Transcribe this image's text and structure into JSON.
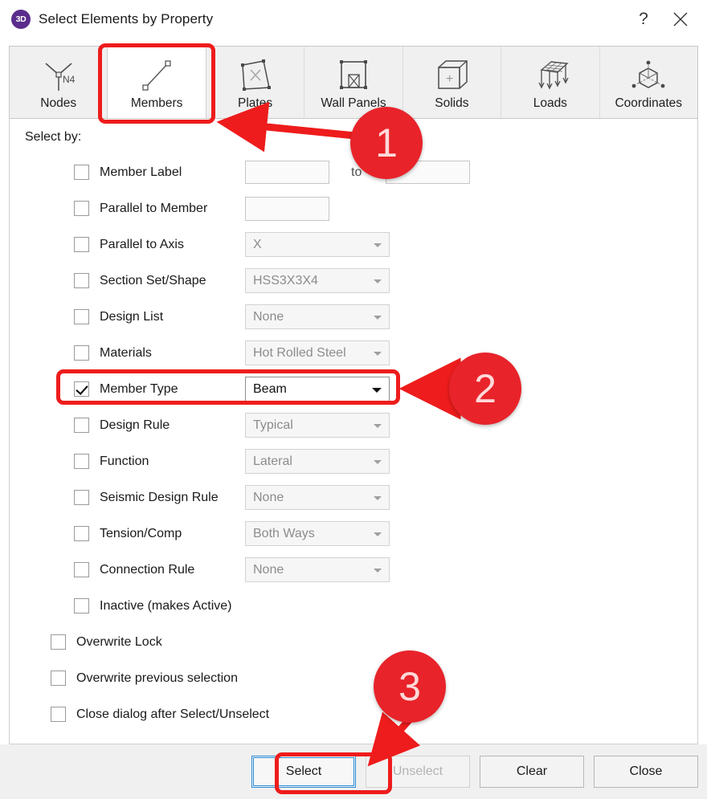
{
  "titlebar": {
    "app_badge": "3D",
    "title": "Select Elements by Property",
    "help_label": "?",
    "close_label": "Close"
  },
  "tabs": [
    {
      "label": "Nodes",
      "icon": "nodes-icon",
      "active": false
    },
    {
      "label": "Members",
      "icon": "members-icon",
      "active": true
    },
    {
      "label": "Plates",
      "icon": "plates-icon",
      "active": false
    },
    {
      "label": "Wall Panels",
      "icon": "wall-panels-icon",
      "active": false
    },
    {
      "label": "Solids",
      "icon": "solids-icon",
      "active": false
    },
    {
      "label": "Loads",
      "icon": "loads-icon",
      "active": false
    },
    {
      "label": "Coordinates",
      "icon": "coordinates-icon",
      "active": false
    }
  ],
  "node_icon_label": "N4",
  "panel": {
    "select_by_label": "Select by:",
    "to_label": "to",
    "rows": [
      {
        "label": "Member Label",
        "checked": false,
        "control": "range",
        "value": "",
        "value2": ""
      },
      {
        "label": "Parallel to Member",
        "checked": false,
        "control": "text",
        "value": ""
      },
      {
        "label": "Parallel to Axis",
        "checked": false,
        "control": "combo",
        "value": "X",
        "enabled": false
      },
      {
        "label": "Section Set/Shape",
        "checked": false,
        "control": "combo",
        "value": "HSS3X3X4",
        "enabled": false
      },
      {
        "label": "Design List",
        "checked": false,
        "control": "combo",
        "value": "None",
        "enabled": false
      },
      {
        "label": "Materials",
        "checked": false,
        "control": "combo",
        "value": "Hot Rolled Steel",
        "enabled": false
      },
      {
        "label": "Member Type",
        "checked": true,
        "control": "combo",
        "value": "Beam",
        "enabled": true
      },
      {
        "label": "Design Rule",
        "checked": false,
        "control": "combo",
        "value": "Typical",
        "enabled": false
      },
      {
        "label": "Function",
        "checked": false,
        "control": "combo",
        "value": "Lateral",
        "enabled": false
      },
      {
        "label": "Seismic Design Rule",
        "checked": false,
        "control": "combo",
        "value": "None",
        "enabled": false
      },
      {
        "label": "Tension/Comp",
        "checked": false,
        "control": "combo",
        "value": "Both Ways",
        "enabled": false
      },
      {
        "label": "Connection Rule",
        "checked": false,
        "control": "combo",
        "value": "None",
        "enabled": false
      },
      {
        "label": "Inactive (makes Active)",
        "checked": false,
        "control": "none"
      }
    ],
    "options": [
      {
        "label": "Overwrite Lock",
        "checked": false
      },
      {
        "label": "Overwrite previous selection",
        "checked": false
      },
      {
        "label": "Close dialog after Select/Unselect",
        "checked": false
      }
    ]
  },
  "footer": {
    "buttons": [
      {
        "label": "Select",
        "state": "focused"
      },
      {
        "label": "Unselect",
        "state": "disabled"
      },
      {
        "label": "Clear",
        "state": "normal"
      },
      {
        "label": "Close",
        "state": "normal"
      }
    ]
  },
  "annotations": {
    "badges": [
      {
        "text": "1"
      },
      {
        "text": "2"
      },
      {
        "text": "3"
      }
    ],
    "accent_color": "#e8232a",
    "highlight_color": "#ee1c1c"
  }
}
